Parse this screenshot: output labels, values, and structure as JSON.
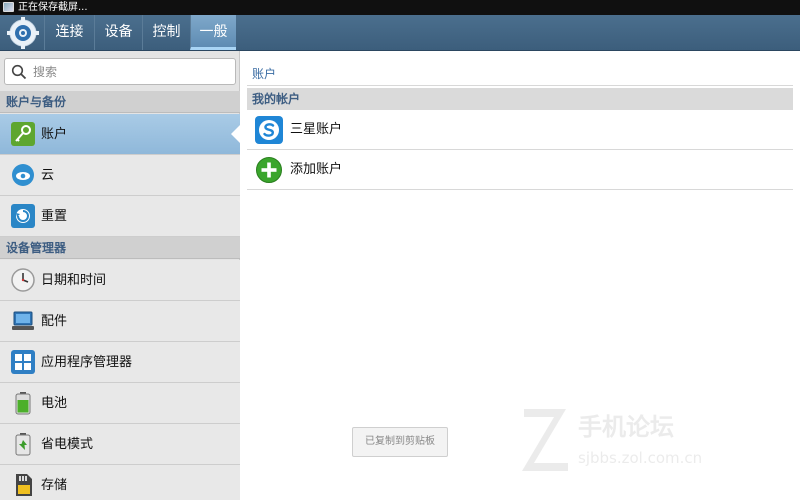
{
  "status_bar": {
    "text": "正在保存截屏..."
  },
  "tabs": [
    {
      "label": "连接"
    },
    {
      "label": "设备"
    },
    {
      "label": "控制"
    },
    {
      "label": "一般"
    }
  ],
  "search": {
    "placeholder": "搜索"
  },
  "sidebar": {
    "sections": [
      {
        "title": "账户与备份",
        "items": [
          {
            "label": "账户",
            "icon": "key-icon"
          },
          {
            "label": "云",
            "icon": "cloud-icon"
          },
          {
            "label": "重置",
            "icon": "reset-icon"
          }
        ]
      },
      {
        "title": "设备管理器",
        "items": [
          {
            "label": "日期和时间",
            "icon": "clock-icon"
          },
          {
            "label": "配件",
            "icon": "accessory-icon"
          },
          {
            "label": "应用程序管理器",
            "icon": "app-manager-icon"
          },
          {
            "label": "电池",
            "icon": "battery-icon"
          },
          {
            "label": "省电模式",
            "icon": "power-saving-icon"
          },
          {
            "label": "存储",
            "icon": "storage-icon"
          }
        ]
      }
    ],
    "selected": "账户"
  },
  "main": {
    "title": "账户",
    "my_accounts_header": "我的帐户",
    "accounts": [
      {
        "label": "三星账户",
        "icon": "samsung-account-icon"
      },
      {
        "label": "添加账户",
        "icon": "add-icon"
      }
    ]
  },
  "toast": {
    "text": "已复制到剪贴板"
  },
  "watermark": {
    "text": "手机论坛",
    "url": "sjbbs.zol.com.cn"
  },
  "colors": {
    "accent": "#3a6ca3",
    "tab_bar": "#3c5e7c",
    "selected_row": "#9bc1e0"
  }
}
